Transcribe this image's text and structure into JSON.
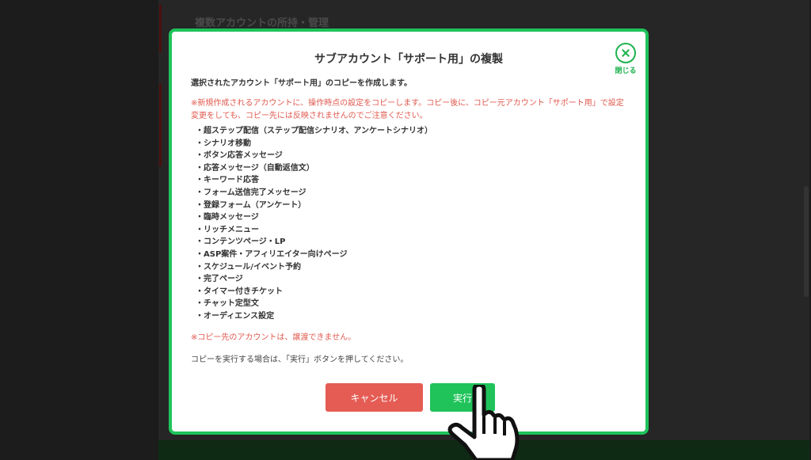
{
  "background": {
    "heading": "複数アカウントの所持・管理"
  },
  "modal": {
    "title": "サブアカウント「サポート用」の複製",
    "close_label": "閉じる",
    "intro": "選択されたアカウント「サポート用」のコピーを作成します。",
    "warning": "※新規作成されるアカウントに、操作時点の設定をコピーします。コピー後に、コピー元アカウント「サポート用」で設定変更をしても、コピー先には反映されませんのでご注意ください。",
    "items": [
      "・超ステップ配信（ステップ配信シナリオ、アンケートシナリオ）",
      "・シナリオ移動",
      "・ボタン応答メッセージ",
      "・応答メッセージ（自動返信文）",
      "・キーワード応答",
      "・フォーム送信完了メッセージ",
      "・登録フォーム（アンケート）",
      "・臨時メッセージ",
      "・リッチメニュー",
      "・コンテンツページ・LP",
      "・ASP案件・アフィリエイター向けページ",
      "・スケジュール/イベント予約",
      "・完了ページ",
      "・タイマー付きチケット",
      "・チャット定型文",
      "・オーディエンス設定"
    ],
    "note": "※コピー先のアカウントは、譲渡できません。",
    "instruction": "コピーを実行する場合は、「実行」ボタンを押してください。",
    "cancel_label": "キャンセル",
    "execute_label": "実行"
  },
  "colors": {
    "accent": "#1fc35a",
    "danger": "#e55c55",
    "warning_text": "#e05a4f"
  }
}
